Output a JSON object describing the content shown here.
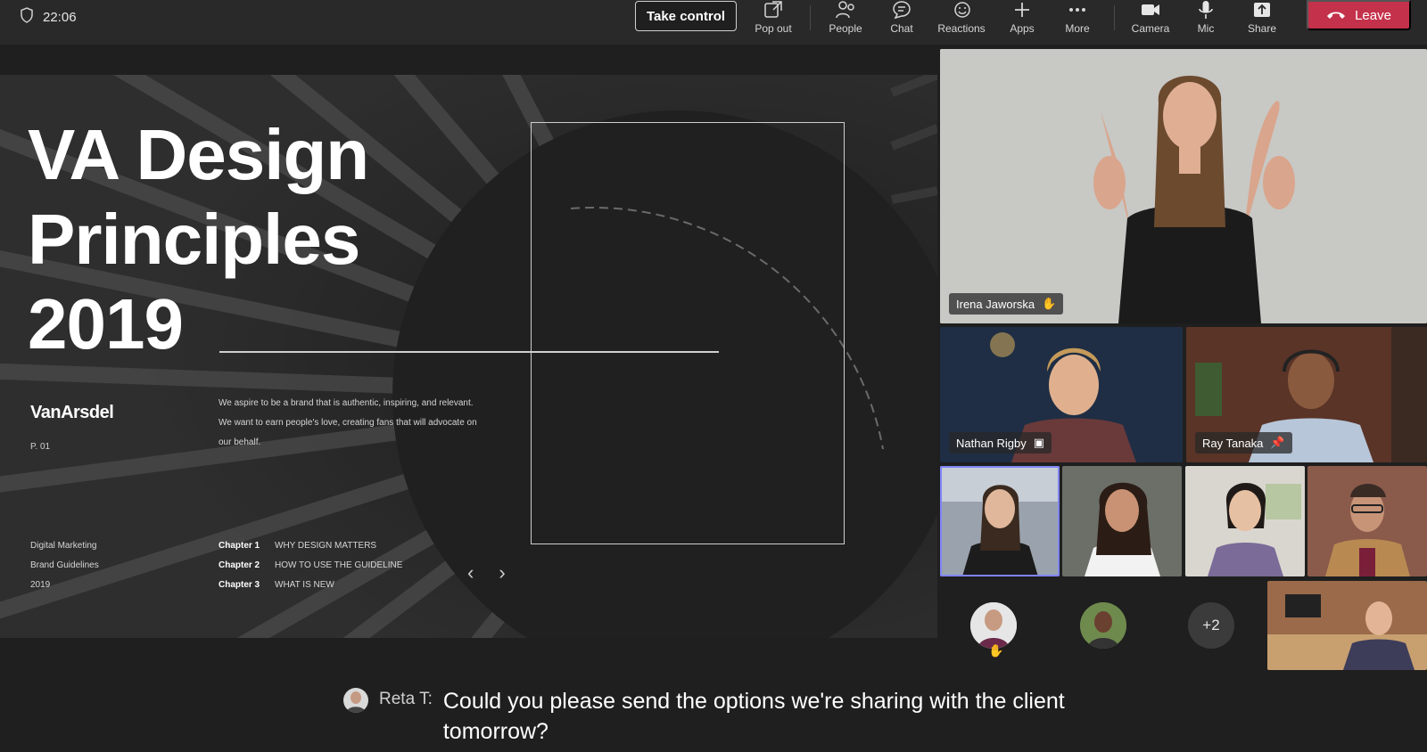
{
  "top_bar": {
    "timer": "22:06",
    "take_control": "Take control",
    "items": {
      "popout": "Pop out",
      "people": "People",
      "chat": "Chat",
      "reactions": "Reactions",
      "apps": "Apps",
      "more": "More",
      "camera": "Camera",
      "mic": "Mic",
      "share": "Share"
    },
    "leave": "Leave"
  },
  "slide": {
    "title_line1": "VA Design",
    "title_line2": "Principles",
    "title_line3": "2019",
    "brand": "VanArsdel",
    "page": "P. 01",
    "description": "We aspire to be a brand that is authentic, inspiring, and relevant. We want to earn people's love, creating fans that will advocate on our behalf.",
    "meta": [
      "Digital Marketing",
      "Brand Guidelines",
      "2019"
    ],
    "chapters": [
      {
        "label": "Chapter 1",
        "title": "WHY DESIGN MATTERS"
      },
      {
        "label": "Chapter 2",
        "title": "HOW TO USE THE GUIDELINE"
      },
      {
        "label": "Chapter 3",
        "title": "WHAT IS NEW"
      }
    ]
  },
  "participants": {
    "main": "Irena Jaworska",
    "p2": "Nathan Rigby",
    "p3": "Ray Tanaka",
    "overflow": "+2"
  },
  "caption": {
    "speaker": "Reta T:",
    "text": "Could you please send the options we're sharing with the client tomorrow?"
  },
  "colors": {
    "leave": "#c4314b",
    "selected_outline": "#7f85f5",
    "bar": "#292929"
  }
}
